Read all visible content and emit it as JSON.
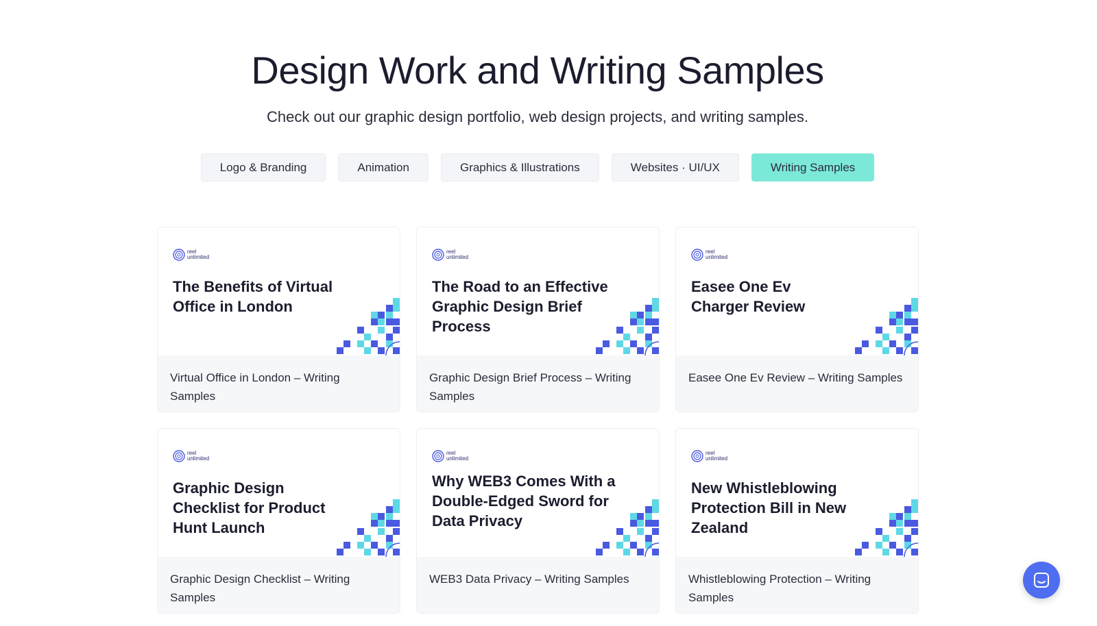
{
  "header": {
    "title": "Design Work and Writing Samples",
    "subtitle": "Check out our graphic design portfolio, web design projects, and writing samples."
  },
  "tabs": [
    {
      "label": "Logo & Branding",
      "active": false
    },
    {
      "label": "Animation",
      "active": false
    },
    {
      "label": "Graphics & Illustrations",
      "active": false
    },
    {
      "label": "Websites · UI/UX",
      "active": false
    },
    {
      "label": "Writing Samples",
      "active": true
    }
  ],
  "brand": {
    "line1": "reel",
    "line2": "unlimited"
  },
  "cards": [
    {
      "thumb_title": "The Benefits of Virtual Office in London",
      "caption": "Virtual Office in London – Writing Samples"
    },
    {
      "thumb_title": "The Road to an Effective Graphic Design Brief Process",
      "caption": "Graphic Design Brief Process – Writing Samples"
    },
    {
      "thumb_title": "Easee One Ev Charger Review",
      "caption": "Easee One Ev Review – Writing Samples"
    },
    {
      "thumb_title": "Graphic Design Checklist for Product Hunt Launch",
      "caption": "Graphic Design Checklist – Writing Samples"
    },
    {
      "thumb_title": "Why WEB3 Comes With a Double-Edged Sword for Data Privacy",
      "caption": "WEB3 Data Privacy – Writing Samples"
    },
    {
      "thumb_title": "New Whistleblowing Protection Bill in New Zealand",
      "caption": "Whistleblowing Protection – Writing Samples"
    }
  ],
  "chat": {
    "icon": "chat-icon"
  },
  "colors": {
    "accent": "#7ce9d8",
    "tab_bg": "#f4f5f8",
    "chat": "#4f6df0",
    "deco_blue": "#4a5ae0",
    "deco_cyan": "#5fd8e6"
  }
}
